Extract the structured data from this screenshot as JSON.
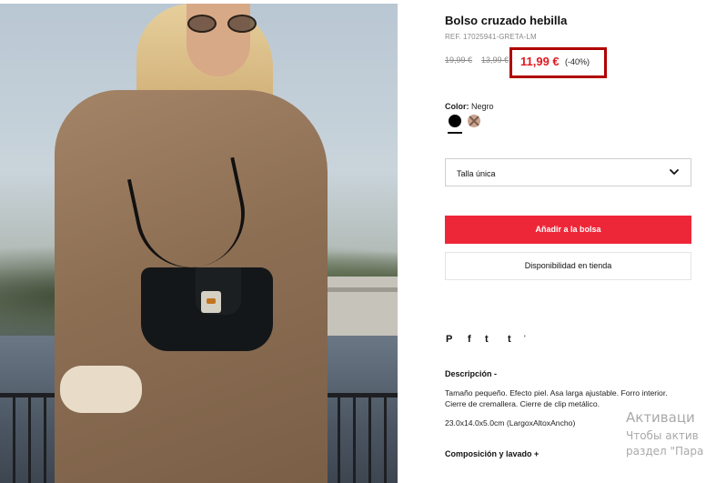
{
  "product": {
    "title": "Bolso cruzado hebilla",
    "ref": "REF. 17025941-GRETA-LM",
    "old_price_1": "19,99 €",
    "old_price_2": "13,99 €",
    "price": "11,99 €",
    "discount": "(-40%)",
    "accent_color": "#e0191f",
    "highlight_box_color": "#b00000"
  },
  "color": {
    "label": "Color:",
    "selected": "Negro",
    "swatches": [
      {
        "name": "Negro",
        "hex": "#000000",
        "available": true
      },
      {
        "name": "",
        "hex": "#c9a38e",
        "available": false
      }
    ]
  },
  "size": {
    "selected": "Talla única",
    "icon": "chevron-down-icon"
  },
  "actions": {
    "add_to_bag": "Añadir a la bolsa",
    "add_to_bag_color": "#ee2738",
    "store_availability": "Disponibilidad en tienda"
  },
  "share": {
    "icons": [
      "pinterest-icon",
      "facebook-icon",
      "twitter-icon",
      "tumblr-icon"
    ],
    "glyphs": [
      "P",
      "f",
      "t",
      "t"
    ],
    "extra": "'"
  },
  "description": {
    "heading": "Descripción -",
    "text": "Tamaño pequeño. Efecto piel. Asa larga ajustable. Forro interior. Cierre de cremallera. Cierre de clip metálico.",
    "dimensions": "23.0x14.0x5.0cm (LargoxAltoxAncho)"
  },
  "composition": {
    "heading": "Composición y lavado +"
  },
  "watermark": {
    "line1": "Активаци",
    "line2": "Чтобы актив",
    "line3": "раздел \"Пара"
  }
}
